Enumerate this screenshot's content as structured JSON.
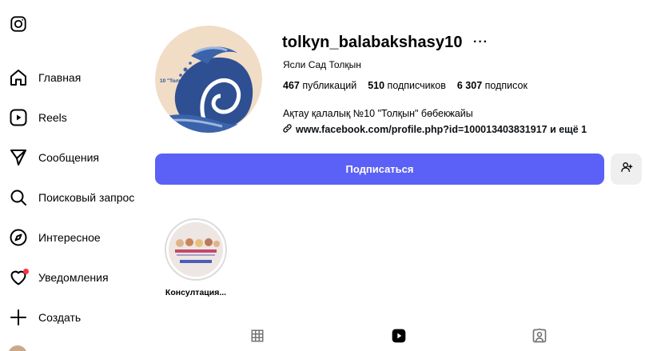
{
  "sidebar": {
    "logo_icon": "instagram-icon",
    "items": [
      {
        "label": "Главная",
        "icon": "home-icon"
      },
      {
        "label": "Reels",
        "icon": "reels-icon"
      },
      {
        "label": "Сообщения",
        "icon": "send-icon"
      },
      {
        "label": "Поисковый запрос",
        "icon": "search-icon"
      },
      {
        "label": "Интересное",
        "icon": "compass-icon"
      },
      {
        "label": "Уведомления",
        "icon": "heart-icon"
      },
      {
        "label": "Создать",
        "icon": "plus-icon"
      }
    ]
  },
  "profile": {
    "username": "tolkyn_balabakshasy10",
    "more": "···",
    "full_name": "Ясли Сад Толқын",
    "stats": {
      "posts_count": "467",
      "posts_label": "публикаций",
      "followers_count": "510",
      "followers_label": "подписчиков",
      "following_count": "6 307",
      "following_label": "подписок"
    },
    "bio": "Ақтау қалалық №10 \"Толқын\" бөбекжайы",
    "link": "www.facebook.com/profile.php?id=100013403831917 и ещё 1",
    "pic_caption": "10 \"Толқын\" б/м"
  },
  "actions": {
    "follow_label": "Подписаться",
    "suggest_icon": "add-person-icon"
  },
  "highlights": [
    {
      "label": "Консултация..."
    }
  ],
  "tabs": [
    "grid-icon",
    "reels-icon",
    "tagged-icon"
  ],
  "colors": {
    "accent": "#5b60f6",
    "notification": "#ff3040",
    "wave_dark": "#2e4f92",
    "wave_light": "#9cb6df",
    "pic_bg": "#f1dcc6"
  }
}
